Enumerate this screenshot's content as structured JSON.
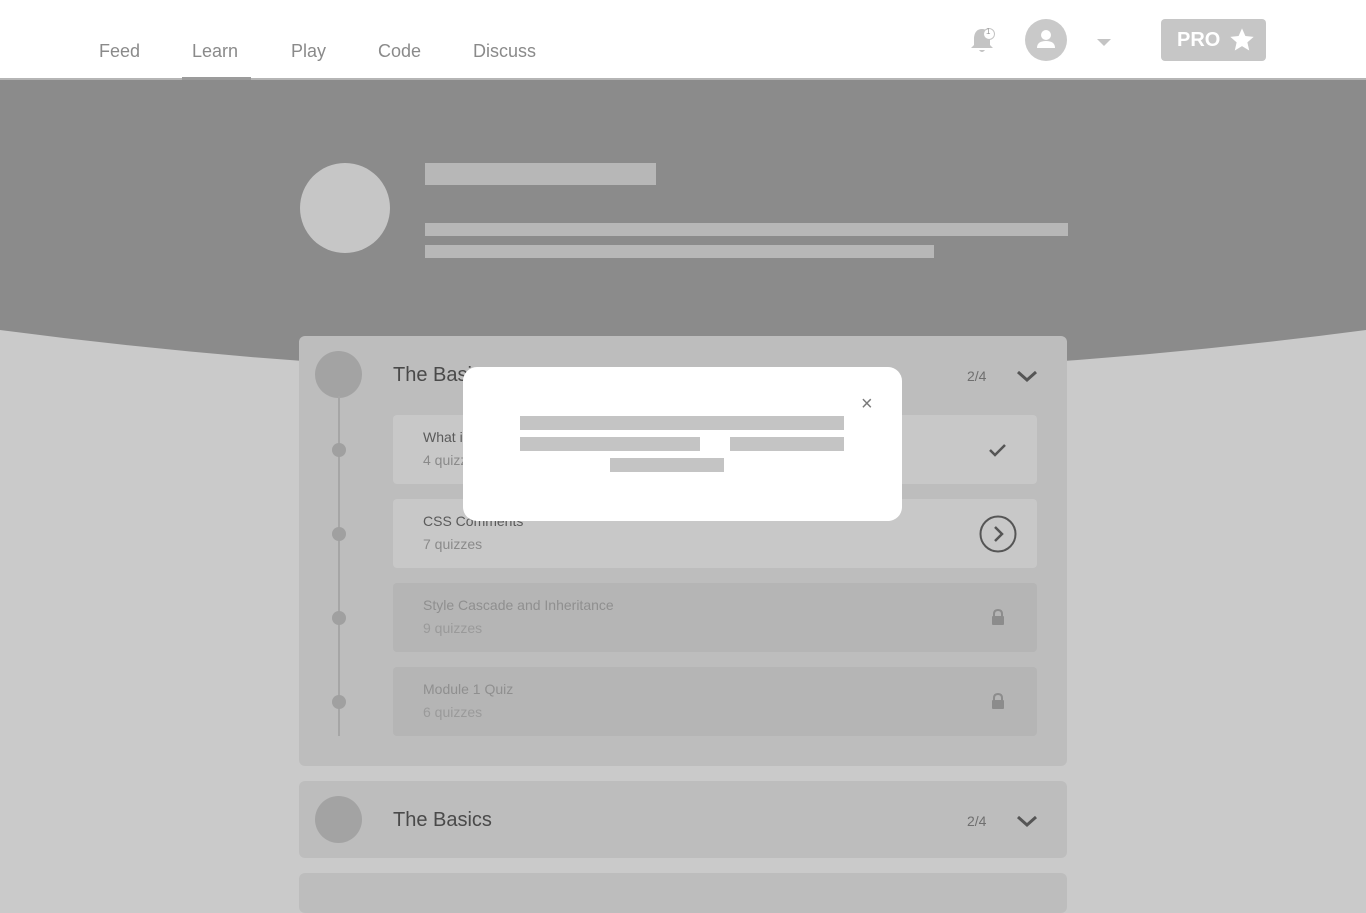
{
  "nav": {
    "tabs": [
      {
        "label": "Feed"
      },
      {
        "label": "Learn",
        "active": true
      },
      {
        "label": "Play"
      },
      {
        "label": "Code"
      },
      {
        "label": "Discuss"
      }
    ],
    "notifications": {
      "icon": "bell-icon",
      "badge": "1"
    },
    "profile": {
      "icon": "user-icon"
    },
    "menu": {
      "icon": "caret-down-icon"
    },
    "pro": {
      "label": "PRO",
      "icon": "star-icon"
    }
  },
  "modules": [
    {
      "title": "The Basics",
      "progress": "2/4",
      "expanded": true,
      "lessons": [
        {
          "title": "What is CSS?",
          "subtitle": "4 quizzes",
          "status": "completed",
          "icon": "check-icon"
        },
        {
          "title": "CSS Comments",
          "subtitle": "7 quizzes",
          "status": "current",
          "icon": "arrow-right-circle-icon"
        },
        {
          "title": "Style Cascade and Inheritance",
          "subtitle": "9 quizzes",
          "status": "locked",
          "icon": "lock-icon"
        },
        {
          "title": "Module 1 Quiz",
          "subtitle": "6 quizzes",
          "status": "locked",
          "icon": "lock-icon"
        }
      ]
    },
    {
      "title": "The Basics",
      "progress": "2/4",
      "expanded": false
    }
  ],
  "modal": {
    "close_label": "×"
  },
  "colors": {
    "hero": "#8b8b8b",
    "page_bg": "#cacaca",
    "card": "#bdbdbd",
    "modal": "#ffffff"
  }
}
